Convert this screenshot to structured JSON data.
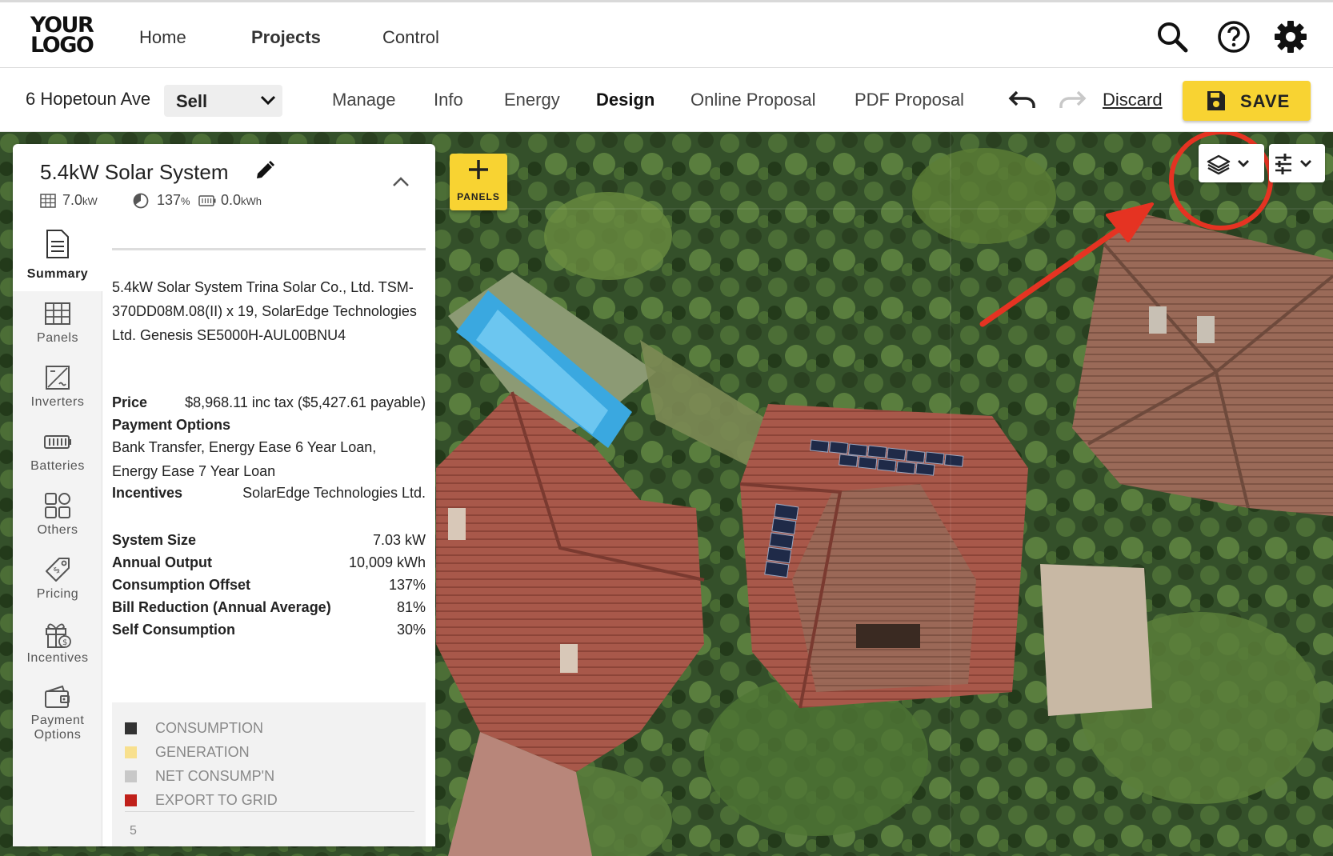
{
  "brand": {
    "logo_line1": "YOUR",
    "logo_line2": "LOGO"
  },
  "nav": {
    "home": "Home",
    "projects": "Projects",
    "control": "Control",
    "icons": [
      "search-icon",
      "help-icon",
      "settings-icon"
    ]
  },
  "project": {
    "address": "6 Hopetoun Ave",
    "stage": "Sell",
    "tabs": [
      "Manage",
      "Info",
      "Energy",
      "Design",
      "Online Proposal",
      "PDF Proposal"
    ],
    "active_tab": "Design",
    "discard": "Discard",
    "save": "SAVE"
  },
  "map": {
    "panels_button": "PANELS",
    "controls": [
      "layers-icon",
      "chevron-down-icon",
      "sliders-icon",
      "chevron-down-icon"
    ]
  },
  "system": {
    "title": "5.4kW Solar System",
    "stat_dc": "7.0",
    "stat_dc_unit": "kW",
    "stat_offset": "137",
    "stat_offset_unit": "%",
    "stat_battery": "0.0",
    "stat_battery_unit": "kWh"
  },
  "sidenav": [
    {
      "label": "Summary",
      "icon": "document-icon"
    },
    {
      "label": "Panels",
      "icon": "grid-icon"
    },
    {
      "label": "Inverters",
      "icon": "inverter-icon"
    },
    {
      "label": "Batteries",
      "icon": "battery-icon"
    },
    {
      "label": "Others",
      "icon": "others-icon"
    },
    {
      "label": "Pricing",
      "icon": "price-tag-icon"
    },
    {
      "label": "Incentives",
      "icon": "gift-icon"
    },
    {
      "label": "Payment\nOptions",
      "icon": "wallet-icon"
    }
  ],
  "summary": {
    "description": "5.4kW Solar System Trina Solar Co., Ltd. TSM-370DD08M.08(II) x 19, SolarEdge Technologies Ltd. Genesis SE5000H-AUL00BNU4",
    "price_label": "Price",
    "price_value": "$8,968.11 inc tax ($5,427.61 payable)",
    "payment_label": "Payment Options",
    "payment_value": "Bank Transfer, Energy Ease 6 Year Loan, Energy Ease 7 Year Loan",
    "incentives_label": "Incentives",
    "incentives_value": "SolarEdge Technologies Ltd.",
    "metrics": [
      {
        "label": "System Size",
        "value": "7.03 kW"
      },
      {
        "label": "Annual Output",
        "value": "10,009 kWh"
      },
      {
        "label": "Consumption Offset",
        "value": "137%"
      },
      {
        "label": "Bill Reduction (Annual Average)",
        "value": "81%"
      },
      {
        "label": "Self Consumption",
        "value": "30%"
      }
    ]
  },
  "legend": {
    "items": [
      {
        "label": "CONSUMPTION",
        "color": "#333333"
      },
      {
        "label": "GENERATION",
        "color": "#f8e08e"
      },
      {
        "label": "NET CONSUMP'N",
        "color": "#c8c8c8"
      },
      {
        "label": "EXPORT TO GRID",
        "color": "#c0201a"
      }
    ],
    "axis_top": "5"
  },
  "colors": {
    "accent": "#f8d332",
    "annotation": "#e53322"
  }
}
